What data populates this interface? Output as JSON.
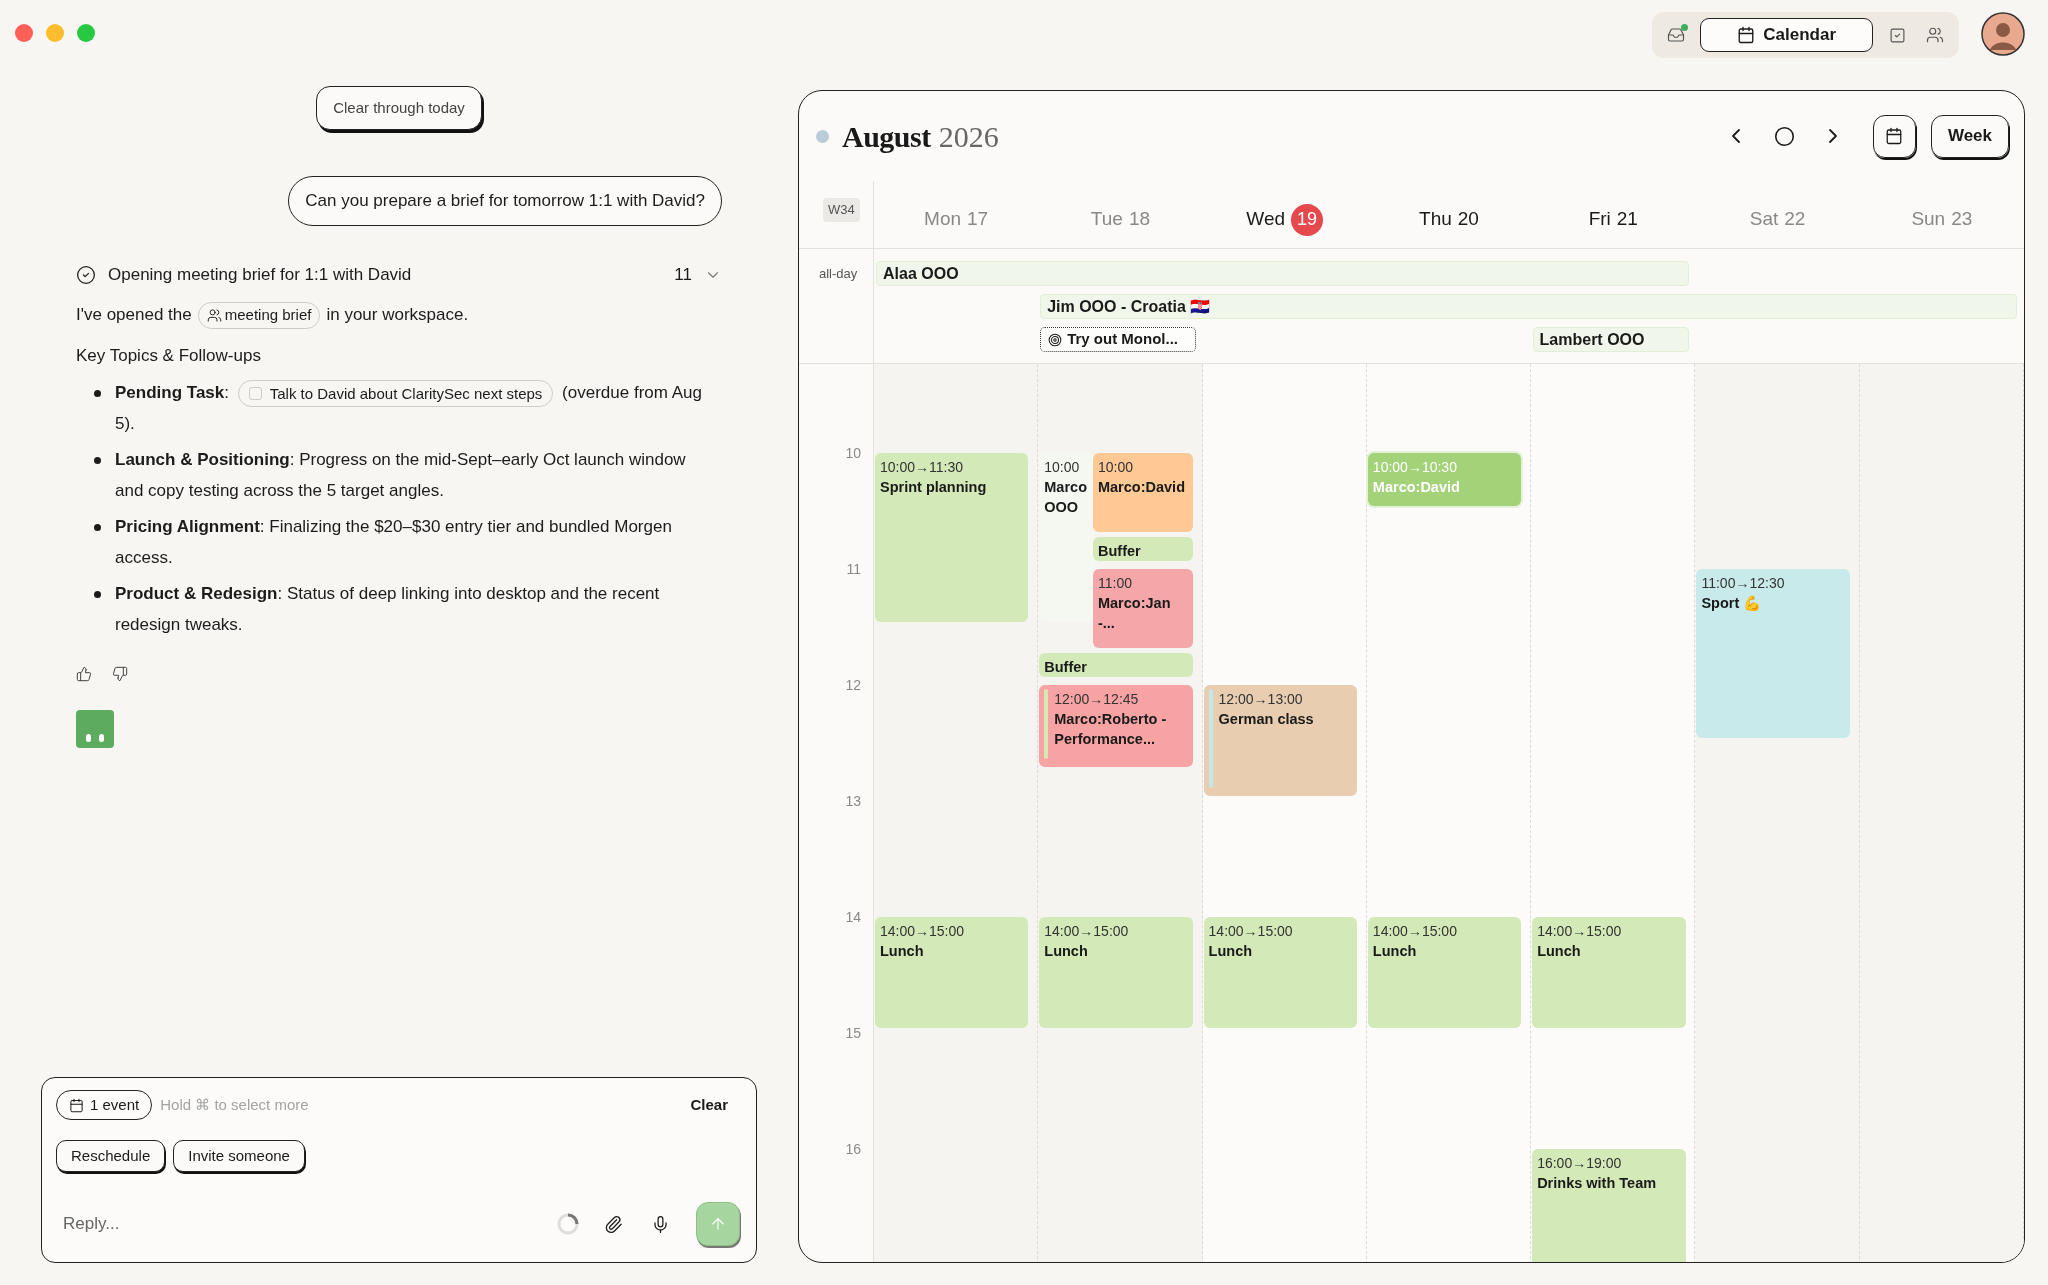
{
  "chat": {
    "clear_button": "Clear through today",
    "user_message": "Can you prepare a brief for tomorrow 1:1 with David?",
    "status": {
      "label": "Opening meeting brief for 1:1 with David",
      "count": "11",
      "done": true,
      "expanded": false
    },
    "intro": {
      "before": "I've opened the",
      "chip": "meeting brief",
      "after": "in your workspace."
    },
    "heading": "Key Topics & Follow-ups",
    "bullets": [
      {
        "text": "**Pending Task**:",
        "task": {
          "label": "Talk to David about ClaritySec next steps",
          "checked": false
        },
        "after": "(overdue from Aug 5)."
      },
      {
        "text": "**Launch & Positioning**: Progress on the mid-Sept–early Oct launch window and copy testing across the 5 target angles."
      },
      {
        "text": "**Pricing Alignment**: Finalizing the $20–$30 entry tier and bundled Morgen access."
      },
      {
        "text": "**Product & Redesign**: Status of deep linking into desktop and the recent redesign tweaks."
      }
    ]
  },
  "composer": {
    "selection": "1 event",
    "hint": "Hold ⌘ to select more",
    "clear": "Clear",
    "actions": [
      "Reschedule",
      "Invite someone"
    ],
    "placeholder": "Reply..."
  },
  "top_bar": {
    "tabs": [
      {
        "kind": "inbox",
        "selected": false,
        "unread": true
      },
      {
        "kind": "calendar",
        "label": "Calendar",
        "selected": true,
        "unread": false
      },
      {
        "kind": "tasks",
        "selected": false,
        "unread": false
      },
      {
        "kind": "people",
        "selected": false,
        "unread": false
      }
    ]
  },
  "calendar": {
    "month": "August",
    "year": "2026",
    "week": "W34",
    "view": "Week",
    "all_day_label": "all-day",
    "hours": [
      "10",
      "11",
      "12",
      "13",
      "14",
      "15",
      "16"
    ],
    "days": [
      {
        "name": "Mon",
        "date": "17",
        "today": false,
        "dimmed": true,
        "events": [
          {
            "kind": "meeting",
            "time": "10:00→11:30",
            "title": "Sprint planning",
            "color": "#d3e9b7",
            "selected": false,
            "shared": false
          },
          {
            "kind": "meeting",
            "time": "14:00→15:00",
            "title": "Lunch",
            "color": "#d3e9b7",
            "selected": false,
            "shared": false
          }
        ]
      },
      {
        "name": "Tue",
        "date": "18",
        "today": false,
        "dimmed": true,
        "events": [
          {
            "kind": "ooo",
            "time": "10:00",
            "title": "Marco OOO",
            "color": "#f5f8f1",
            "selected": false,
            "shared": false
          },
          {
            "kind": "meeting",
            "time": "10:00",
            "title": "Marco:David",
            "color": "#fec995",
            "selected": false,
            "shared": true
          },
          {
            "kind": "buffer",
            "title": "Buffer",
            "color": "#d3e9b7",
            "selected": false,
            "shared": true
          },
          {
            "kind": "meeting",
            "time": "11:00",
            "title": "Marco:Jan -...",
            "color": "#f4a6a8",
            "selected": false,
            "shared": true
          },
          {
            "kind": "buffer",
            "title": "Buffer",
            "color": "#d3e9b7",
            "selected": false,
            "shared": false
          },
          {
            "kind": "meeting",
            "time": "12:00→12:45",
            "title": "Marco:Roberto - Performance...",
            "color": "#f7a3a3",
            "stripe": {
              "color": "#d7e8b4"
            },
            "selected": false,
            "shared": false
          },
          {
            "kind": "meeting",
            "time": "14:00→15:00",
            "title": "Lunch",
            "color": "#d3e9b7",
            "selected": false,
            "shared": false
          }
        ]
      },
      {
        "name": "Wed",
        "date": "19",
        "today": true,
        "dimmed": false,
        "events": [
          {
            "kind": "meeting",
            "time": "12:00→13:00",
            "title": "German class",
            "color": "#e8cdb1",
            "stripe": {
              "color": "#c3e6ea"
            },
            "selected": false,
            "shared": false
          },
          {
            "kind": "meeting",
            "time": "14:00→15:00",
            "title": "Lunch",
            "color": "#d3e9b7",
            "selected": false,
            "shared": false
          }
        ]
      },
      {
        "name": "Thu",
        "date": "20",
        "today": false,
        "dimmed": false,
        "events": [
          {
            "kind": "meeting",
            "time": "10:00→10:30",
            "title": "Marco:David",
            "color": "#a3d279",
            "selected": true,
            "shared": false
          },
          {
            "kind": "meeting",
            "time": "14:00→15:00",
            "title": "Lunch",
            "color": "#d3e9b7",
            "selected": false,
            "shared": false
          }
        ]
      },
      {
        "name": "Fri",
        "date": "21",
        "today": false,
        "dimmed": false,
        "events": [
          {
            "kind": "meeting",
            "time": "14:00→15:00",
            "title": "Lunch",
            "color": "#d3e9b7",
            "selected": false,
            "shared": false
          },
          {
            "kind": "meeting",
            "time": "16:00→19:00",
            "title": "Drinks with Team",
            "color": "#d3e9b7",
            "selected": false,
            "shared": false
          }
        ]
      },
      {
        "name": "Sat",
        "date": "22",
        "today": false,
        "dimmed": true,
        "events": [
          {
            "kind": "meeting",
            "time": "11:00→12:30",
            "title": "Sport 💪",
            "color": "#c9eaea",
            "selected": false,
            "shared": false
          }
        ]
      },
      {
        "name": "Sun",
        "date": "23",
        "today": false,
        "dimmed": true
      }
    ],
    "all_day": [
      [
        {
          "kind": "bar",
          "title": "Alaa OOO"
        },
        {
          "kind": "continued"
        },
        {
          "kind": "continued"
        },
        {
          "kind": "continued"
        },
        {
          "kind": "continued"
        },
        {
          "kind": "empty"
        },
        {
          "kind": "empty"
        }
      ],
      [
        {
          "kind": "empty"
        },
        {
          "kind": "bar",
          "title": "Jim OOO - Croatia 🇭🇷"
        },
        {
          "kind": "continued"
        },
        {
          "kind": "continued"
        },
        {
          "kind": "continued"
        },
        {
          "kind": "continued"
        },
        {
          "kind": "continued"
        }
      ],
      [
        {
          "kind": "empty"
        },
        {
          "kind": "task",
          "title": "Try out Monol..."
        },
        {
          "kind": "empty"
        },
        {
          "kind": "empty"
        },
        {
          "kind": "bar",
          "title": "Lambert OOO"
        },
        {
          "kind": "empty"
        },
        {
          "kind": "empty"
        }
      ]
    ]
  }
}
